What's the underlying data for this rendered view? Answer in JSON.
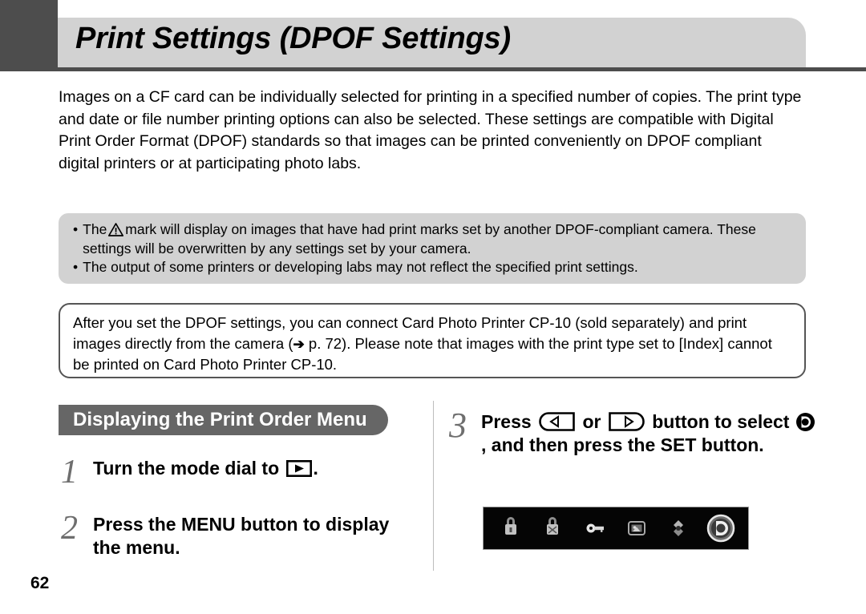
{
  "header": {
    "title": "Print Settings (DPOF  Settings)"
  },
  "intro": {
    "paragraph": "Images on a CF card can be individually selected for printing in a specified number of copies. The print type and date or file number printing options can also be selected. These settings are compatible with Digital Print Order Format (DPOF) standards so that images can be printed conveniently on DPOF compliant digital printers or at participating photo labs."
  },
  "note_box": {
    "bullet_char": "•",
    "items": [
      {
        "text_before_icon": "The",
        "icon": "warning-triangle-icon",
        "text_after_icon": "mark will display on images that have had print marks set by another DPOF-compliant camera. These settings will be overwritten by any settings set by your camera."
      },
      {
        "text_before_icon": "The output of some printers or developing labs may not reflect the specified print settings.",
        "icon": "",
        "text_after_icon": ""
      }
    ]
  },
  "cp10_box": {
    "text_part_1": "After you set the DPOF settings, you can connect Card Photo Printer CP-10 (sold separately) and print images directly from the camera (",
    "arrow_glyph": "➔",
    "text_part_2": " p. 72). Please note that images with the print type set to [Index] cannot be printed on Card Photo Printer CP-10."
  },
  "section": {
    "banner_label": "Displaying the Print Order Menu"
  },
  "steps": [
    {
      "number": "1",
      "text_before_icon": "Turn the mode dial to ",
      "icon": "playback-mode-icon",
      "text_after_icon": "."
    },
    {
      "number": "2",
      "text_before_icon": "Press the MENU button to display the menu.",
      "icon": "",
      "text_after_icon": ""
    },
    {
      "number": "3",
      "text_1": "Press ",
      "icon_left": "left-arrow-button-icon",
      "text_2": " or ",
      "icon_right": "right-arrow-button-icon",
      "text_3": " button to select ",
      "icon_dpof": "print-order-icon",
      "text_4": ", and then press the SET button."
    }
  ],
  "lcd_strip": {
    "icons": [
      {
        "name": "protect-icon",
        "selected": false
      },
      {
        "name": "erase-all-icon",
        "selected": false
      },
      {
        "name": "key-icon",
        "selected": false
      },
      {
        "name": "slide-show-icon",
        "selected": false
      },
      {
        "name": "transfer-order-icon",
        "selected": false
      },
      {
        "name": "print-order-icon",
        "selected": true
      }
    ]
  },
  "footer": {
    "page_number": "62"
  },
  "colors": {
    "header_tab": "#4d4d4d",
    "title_bar": "#d2d2d2",
    "note_box": "#d2d2d2",
    "banner": "#666666",
    "step_number": "#6e6e6e",
    "lcd_background": "#050505"
  }
}
